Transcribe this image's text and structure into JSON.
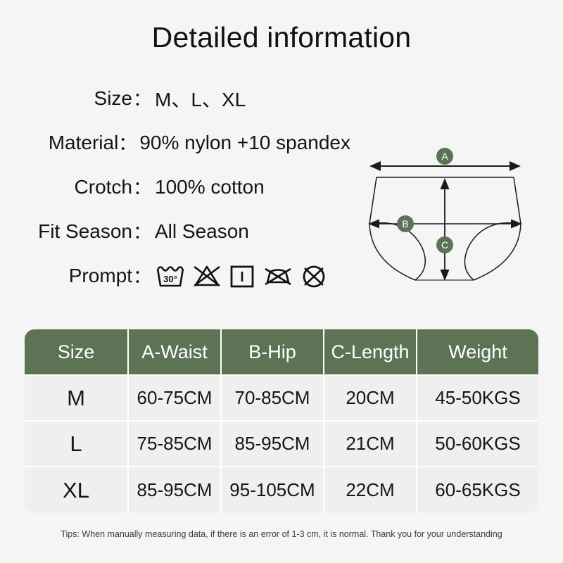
{
  "page": {
    "title": "Detailed information",
    "background_color": "#f5f5f5",
    "accent_color": "#5c7356"
  },
  "specs": [
    {
      "label": "Size",
      "colon": "：",
      "value": "M、L、XL"
    },
    {
      "label": "Material",
      "colon": "：",
      "value": "90% nylon +10 spandex"
    },
    {
      "label": "Crotch",
      "colon": "：",
      "value": "100% cotton"
    },
    {
      "label": "Fit Season",
      "colon": "：",
      "value": "All Season"
    },
    {
      "label": "Prompt",
      "colon": "：",
      "value": ""
    }
  ],
  "care_symbols": [
    {
      "name": "wash-30-degrees-icon",
      "label": "30°"
    },
    {
      "name": "do-not-bleach-icon",
      "label": ""
    },
    {
      "name": "drip-dry-icon",
      "label": ""
    },
    {
      "name": "do-not-iron-icon",
      "label": ""
    },
    {
      "name": "do-not-dry-clean-icon",
      "label": ""
    }
  ],
  "diagram": {
    "badges": [
      {
        "name": "measure-badge-a",
        "letter": "A",
        "meaning": "Waist"
      },
      {
        "name": "measure-badge-b",
        "letter": "B",
        "meaning": "Hip"
      },
      {
        "name": "measure-badge-c",
        "letter": "C",
        "meaning": "Length"
      }
    ],
    "badge_color": "#5c7356"
  },
  "size_table": {
    "headers": [
      "Size",
      "A-Waist",
      "B-Hip",
      "C-Length",
      "Weight"
    ],
    "rows": [
      {
        "size": "M",
        "waist": "60-75CM",
        "hip": "70-85CM",
        "length": "20CM",
        "weight": "45-50KGS"
      },
      {
        "size": "L",
        "waist": "75-85CM",
        "hip": "85-95CM",
        "length": "21CM",
        "weight": "50-60KGS"
      },
      {
        "size": "XL",
        "waist": "85-95CM",
        "hip": "95-105CM",
        "length": "22CM",
        "weight": "60-65KGS"
      }
    ]
  },
  "footer": {
    "tip": "Tips: When manually measuring data, if there is an error of 1-3 cm, it is normal. Thank you for your understanding"
  }
}
